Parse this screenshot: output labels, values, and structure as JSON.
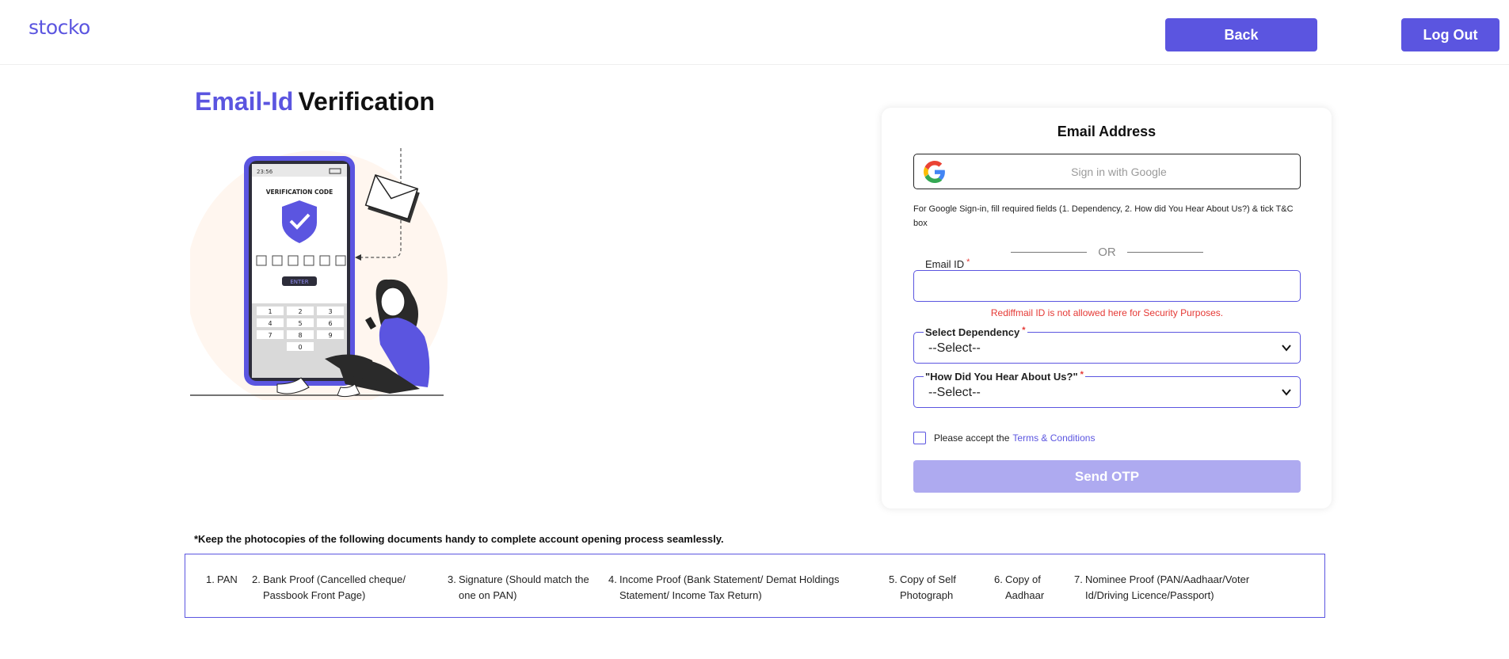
{
  "header": {
    "logo": "stocko",
    "back_label": "Back",
    "logout_label": "Log Out"
  },
  "title": {
    "accent": "Email-Id",
    "rest": "Verification"
  },
  "illustration": {
    "time": "23:56",
    "heading": "VERIFICATION CODE",
    "enter_label": "ENTER",
    "keypad": [
      "1",
      "2",
      "3",
      "4",
      "5",
      "6",
      "7",
      "8",
      "9",
      "0"
    ]
  },
  "form": {
    "card_title": "Email Address",
    "google_label": "Sign in with Google",
    "google_note": "For Google Sign-in, fill required fields (1. Dependency, 2. How did You Hear About Us?) & tick T&C box",
    "or_text": "OR",
    "email_label": "Email ID",
    "email_value": "",
    "required_mark": "*",
    "warning": "Rediffmail ID is not allowed here for Security Purposes.",
    "dependency_label": "Select Dependency",
    "dependency_value": "--Select--",
    "hear_label": "\"How Did You Hear About Us?\"",
    "hear_value": "--Select--",
    "tc_text": "Please accept the",
    "tc_link": "Terms & Conditions",
    "send_label": "Send OTP"
  },
  "documents": {
    "note": "*Keep the photocopies of the following documents handy to complete account opening process seamlessly.",
    "items": [
      {
        "num": "1.",
        "text": "PAN"
      },
      {
        "num": "2.",
        "text": "Bank Proof (Cancelled cheque/ Passbook Front Page)"
      },
      {
        "num": "3.",
        "text": "Signature (Should match the one on PAN)"
      },
      {
        "num": "4.",
        "text": "Income Proof (Bank Statement/ Demat Holdings Statement/ Income Tax Return)"
      },
      {
        "num": "5.",
        "text": "Copy of Self Photograph"
      },
      {
        "num": "6.",
        "text": "Copy of Aadhaar"
      },
      {
        "num": "7.",
        "text": "Nominee Proof (PAN/Aadhaar/Voter Id/Driving Licence/Passport)"
      }
    ]
  },
  "colors": {
    "accent": "#5b55e0",
    "accent_disabled": "#aeaaf0",
    "error": "#e53935"
  }
}
